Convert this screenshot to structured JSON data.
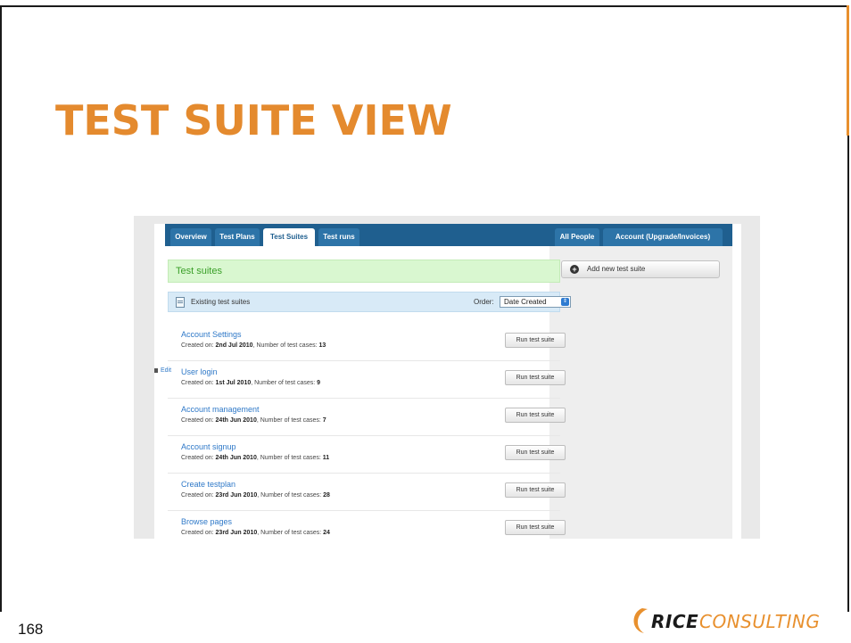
{
  "slide": {
    "title": "TEST SUITE VIEW",
    "page_number": "168",
    "logo": {
      "part1": "RICE",
      "part2": "CONSULTING"
    },
    "colors": {
      "title": "#e48a2e",
      "accent": "#e8902e"
    }
  },
  "app": {
    "nav_tabs": [
      {
        "label": "Overview",
        "active": false
      },
      {
        "label": "Test Plans",
        "active": false
      },
      {
        "label": "Test Suites",
        "active": true
      },
      {
        "label": "Test runs",
        "active": false
      }
    ],
    "nav_right": [
      {
        "label": "All People"
      },
      {
        "label": "Account (Upgrade/Invoices)"
      }
    ],
    "page_heading": "Test suites",
    "section_title": "Existing test suites",
    "order_label": "Order:",
    "order_value": "Date Created",
    "edit_label": "Edit",
    "sidebar": {
      "add_button": "Add new test suite"
    },
    "created_prefix": "Created on: ",
    "cases_prefix": ", Number of test cases: ",
    "run_button_label": "Run test suite",
    "suites": [
      {
        "name": "Account Settings",
        "created": "2nd Jul 2010",
        "cases": "13"
      },
      {
        "name": "User login",
        "created": "1st Jul 2010",
        "cases": "9"
      },
      {
        "name": "Account management",
        "created": "24th Jun 2010",
        "cases": "7"
      },
      {
        "name": "Account signup",
        "created": "24th Jun 2010",
        "cases": "11"
      },
      {
        "name": "Create testplan",
        "created": "23rd Jun 2010",
        "cases": "28"
      },
      {
        "name": "Browse pages",
        "created": "23rd Jun 2010",
        "cases": "24"
      }
    ],
    "colors": {
      "nav": "#1f5f8f",
      "link": "#2f79c8",
      "success_bg": "#d9f7d0",
      "info_bg": "#d8eaf7"
    }
  }
}
